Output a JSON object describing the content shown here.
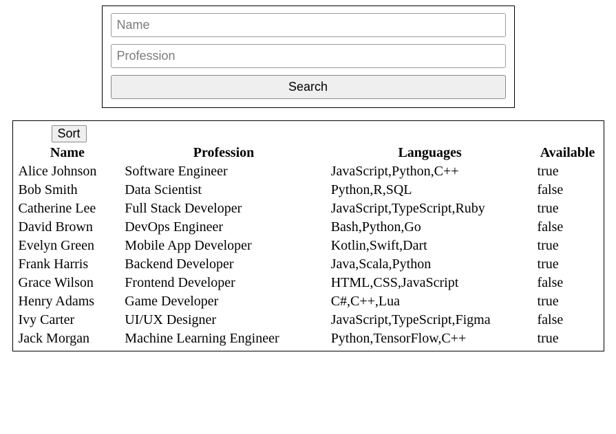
{
  "search": {
    "name_placeholder": "Name",
    "profession_placeholder": "Profession",
    "button_label": "Search"
  },
  "sort_button_label": "Sort",
  "headers": {
    "name": "Name",
    "profession": "Profession",
    "languages": "Languages",
    "available": "Available"
  },
  "rows": [
    {
      "name": "Alice Johnson",
      "profession": "Software Engineer",
      "languages": "JavaScript,Python,C++",
      "available": "true"
    },
    {
      "name": "Bob Smith",
      "profession": "Data Scientist",
      "languages": "Python,R,SQL",
      "available": "false"
    },
    {
      "name": "Catherine Lee",
      "profession": "Full Stack Developer",
      "languages": "JavaScript,TypeScript,Ruby",
      "available": "true"
    },
    {
      "name": "David Brown",
      "profession": "DevOps Engineer",
      "languages": "Bash,Python,Go",
      "available": "false"
    },
    {
      "name": "Evelyn Green",
      "profession": "Mobile App Developer",
      "languages": "Kotlin,Swift,Dart",
      "available": "true"
    },
    {
      "name": "Frank Harris",
      "profession": "Backend Developer",
      "languages": "Java,Scala,Python",
      "available": "true"
    },
    {
      "name": "Grace Wilson",
      "profession": "Frontend Developer",
      "languages": "HTML,CSS,JavaScript",
      "available": "false"
    },
    {
      "name": "Henry Adams",
      "profession": "Game Developer",
      "languages": "C#,C++,Lua",
      "available": "true"
    },
    {
      "name": "Ivy Carter",
      "profession": "UI/UX Designer",
      "languages": "JavaScript,TypeScript,Figma",
      "available": "false"
    },
    {
      "name": "Jack Morgan",
      "profession": "Machine Learning Engineer",
      "languages": "Python,TensorFlow,C++",
      "available": "true"
    }
  ]
}
